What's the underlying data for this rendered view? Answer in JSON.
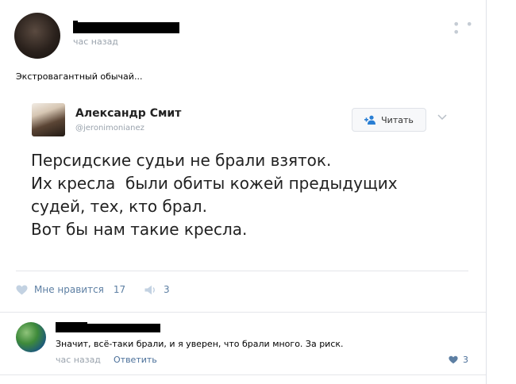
{
  "post": {
    "time": "час назад",
    "text": "Экстровагантный обычай...",
    "likes_label": "Мне нравится",
    "likes_count": "17",
    "shares_count": "3"
  },
  "tweet": {
    "author_name": "Александр Смит",
    "handle": "@jeronimonianez",
    "follow_label": "Читать",
    "lines": [
      "Персидские судьи не брали взяток.",
      "Их кресла  были обиты кожей предыдущих",
      "судей, тех, кто брал.",
      "Вот бы нам такие кресла."
    ]
  },
  "comment": {
    "text": "Значит, всё-таки брали, и я уверен, что брали много. За риск.",
    "time": "час назад",
    "reply_label": "Ответить",
    "likes_count": "3"
  },
  "icons": {
    "menu": "more-dots-icon",
    "follow": "add-user-icon",
    "chevron": "chevron-down-icon",
    "like": "heart-icon",
    "share": "share-icon"
  },
  "colors": {
    "accent": "#5d7fa3",
    "link": "#4a6f99",
    "muted": "#9aa3ad"
  }
}
